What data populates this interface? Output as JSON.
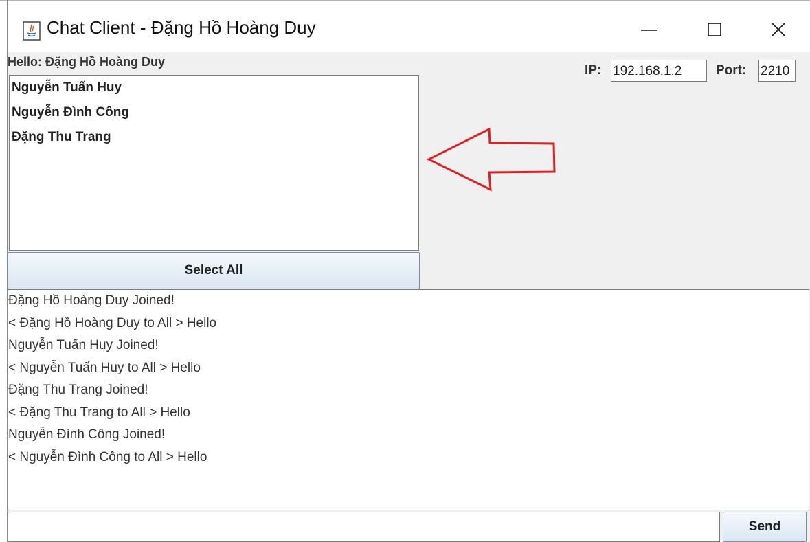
{
  "window": {
    "title": "Chat Client - Đặng Hồ Hoàng Duy",
    "controls": {
      "minimize": "minimize-icon",
      "maximize": "maximize-icon",
      "close": "close-icon"
    }
  },
  "header": {
    "hello": "Hello: Đặng Hồ Hoàng Duy",
    "ip_label": "IP:",
    "ip_value": "192.168.1.2",
    "port_label": "Port:",
    "port_value": "2210"
  },
  "users": [
    "Nguyễn Tuấn Huy",
    "Nguyễn Đình Công",
    "Đặng Thu Trang"
  ],
  "select_all_label": "Select All",
  "chat_log": [
    "Đặng Hồ Hoàng Duy Joined!",
    "< Đặng Hồ Hoàng Duy to All > Hello",
    "Nguyễn Tuấn Huy Joined!",
    "< Nguyễn Tuấn Huy to All > Hello",
    "Đặng Thu Trang Joined!",
    "< Đặng Thu Trang to All > Hello",
    "Nguyễn Đình Công Joined!",
    "< Nguyễn Đình Công to All > Hello"
  ],
  "message_input": {
    "value": ""
  },
  "send_label": "Send",
  "colors": {
    "annotation_arrow": "#e02020",
    "button_gradient_top": "#f4f8fc",
    "button_gradient_bottom": "#dbe6f2"
  },
  "icons": {
    "app": "java-app-icon",
    "annotation": "arrow-left-icon"
  }
}
